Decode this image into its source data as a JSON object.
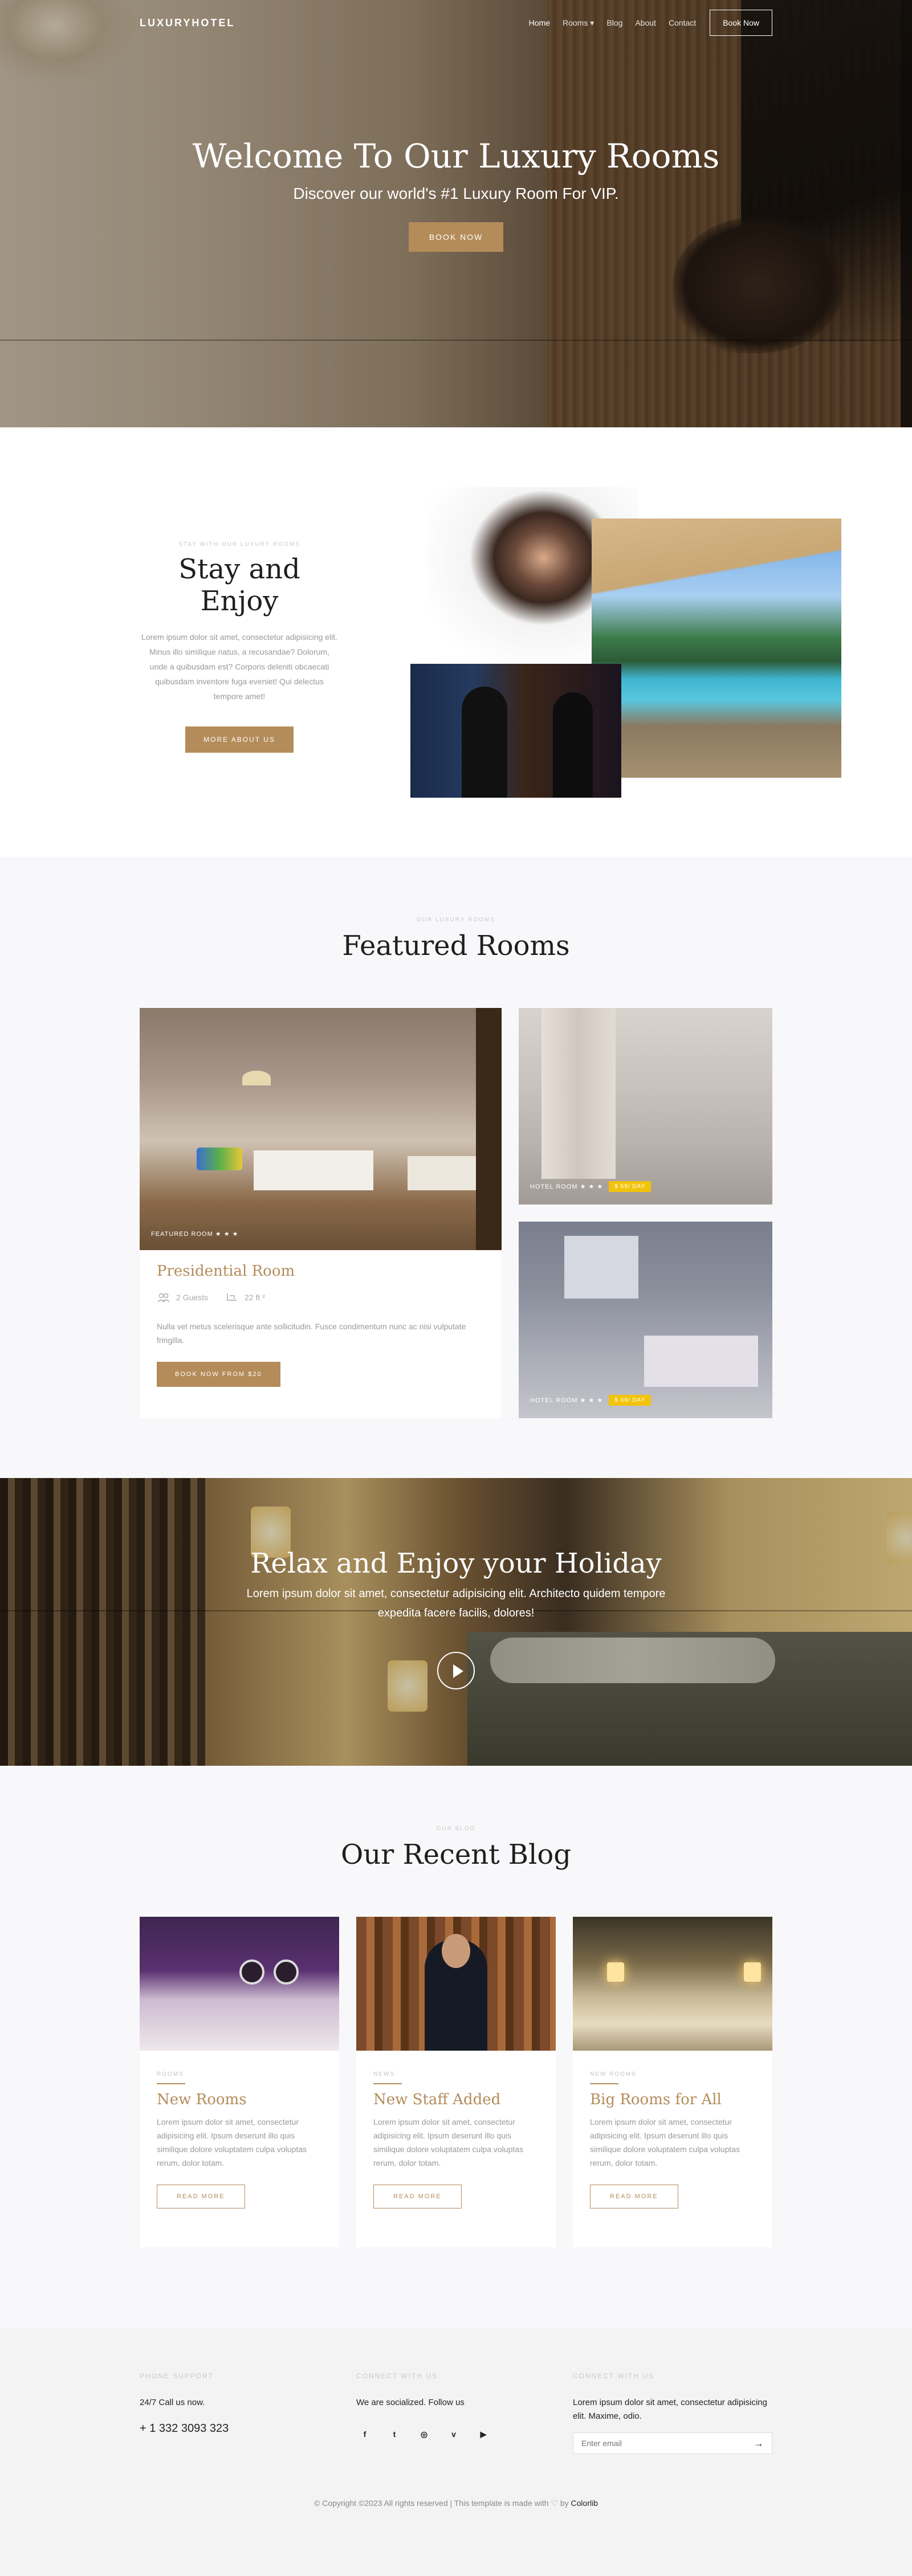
{
  "nav": {
    "logo": "LUXURYHOTEL",
    "links": [
      "Home",
      "Rooms",
      "Blog",
      "About",
      "Contact"
    ],
    "rooms_caret": "▾",
    "book_now": "Book Now"
  },
  "hero": {
    "title": "Welcome To Our Luxury Rooms",
    "subtitle": "Discover our world's #1 Luxury Room For VIP.",
    "button": "BOOK NOW"
  },
  "stay": {
    "eyebrow": "STAY WITH OUR LUXURY ROOMS",
    "title": "Stay and Enjoy",
    "body": "Lorem ipsum dolor sit amet, consectetur adipisicing elit. Minus illo similique natus, a recusandae? Dolorum, unde a quibusdam est? Corporis deleniti obcaecati quibusdam inventore fuga eveniet! Qui delectus tempore amet!",
    "button": "MORE ABOUT US"
  },
  "featured": {
    "eyebrow": "OUR LUXURY ROOMS",
    "title": "Featured Rooms",
    "big": {
      "label": "FEATURED ROOM ★ ★ ★",
      "title": "Presidential Room",
      "guests": "2 Guests",
      "size": "22 ft ²",
      "body": "Nulla vel metus scelerisque ante sollicitudin. Fusce condimentum nunc ac nisi vulputate fringilla.",
      "button": "BOOK NOW FROM $20"
    },
    "small": [
      {
        "label": "HOTEL ROOM ★ ★ ★",
        "badge": "$ 69/ DAY"
      },
      {
        "label": "HOTEL ROOM ★ ★ ★",
        "badge": "$ 69/ DAY"
      }
    ]
  },
  "relax": {
    "title": "Relax and Enjoy your Holiday",
    "body": "Lorem ipsum dolor sit amet, consectetur adipisicing elit. Architecto quidem tempore expedita facere facilis, dolores!"
  },
  "blog": {
    "eyebrow": "OUR BLOG",
    "title": "Our Recent Blog",
    "posts": [
      {
        "category": "ROOMS",
        "title": "New Rooms",
        "body": "Lorem ipsum dolor sit amet, consectetur adipisicing elit. Ipsum deserunt illo quis similique dolore voluptatem culpa voluptas rerum, dolor totam.",
        "button": "READ MORE"
      },
      {
        "category": "NEWS",
        "title": "New Staff Added",
        "body": "Lorem ipsum dolor sit amet, consectetur adipisicing elit. Ipsum deserunt illo quis similique dolore voluptatem culpa voluptas rerum, dolor totam.",
        "button": "READ MORE"
      },
      {
        "category": "NEW ROOMS",
        "title": "Big Rooms for All",
        "body": "Lorem ipsum dolor sit amet, consectetur adipisicing elit. Ipsum deserunt illo quis similique dolore voluptatem culpa voluptas rerum, dolor totam.",
        "button": "READ MORE"
      }
    ]
  },
  "footer": {
    "phone_heading": "PHONE SUPPORT",
    "phone_line": "24/7 Call us now.",
    "phone_number": "+ 1 332 3093 323",
    "connect_heading": "CONNECT WITH US",
    "connect_line": "We are socialized. Follow us",
    "socials": [
      "f",
      "t",
      "◎",
      "v",
      "▶"
    ],
    "subscribe_heading": "CONNECT WITH US",
    "subscribe_line": "Lorem ipsum dolor sit amet, consectetur adipisicing elit. Maxime, odio.",
    "email_placeholder": "Enter email",
    "copyright": "© Copyright ©2023 All rights reserved | This template is made with ♡ by",
    "copyright_brand": "Colorlib"
  },
  "colors": {
    "accent": "#b48c5a",
    "badge": "#f2c30b"
  }
}
